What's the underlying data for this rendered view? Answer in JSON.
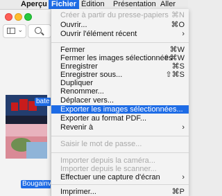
{
  "menubar": {
    "apple_glyph": "",
    "app_name": "Aperçu",
    "menus": [
      "Fichier",
      "Édition",
      "Présentation",
      "Aller"
    ]
  },
  "window": {
    "thumbnails": [
      {
        "label": "bate"
      },
      {
        "label": "Bougainv"
      }
    ]
  },
  "file_menu": {
    "items": [
      {
        "label": "Créer à partir du presse-papiers",
        "shortcut": "⌘N",
        "disabled": true
      },
      {
        "label": "Ouvrir...",
        "shortcut": "⌘O"
      },
      {
        "label": "Ouvrir l'élément récent",
        "shortcut": "›"
      },
      {
        "label": "Fermer",
        "shortcut": "⌘W"
      },
      {
        "label": "Fermer les images sélectionnées",
        "shortcut": "⇧⌘W"
      },
      {
        "label": "Enregistrer",
        "shortcut": "⌘S"
      },
      {
        "label": "Enregistrer sous...",
        "shortcut": "⇧⌘S"
      },
      {
        "label": "Dupliquer",
        "shortcut": ""
      },
      {
        "label": "Renommer...",
        "shortcut": ""
      },
      {
        "label": "Déplacer vers...",
        "shortcut": ""
      },
      {
        "label": "Exporter les images sélectionnées...",
        "shortcut": "",
        "highlighted": true
      },
      {
        "label": "Exporter au format PDF...",
        "shortcut": ""
      },
      {
        "label": "Revenir à",
        "shortcut": "›"
      },
      {
        "label": "Saisir le mot de passe...",
        "shortcut": "",
        "disabled": true
      },
      {
        "label": "Importer depuis la caméra...",
        "shortcut": "",
        "disabled": true
      },
      {
        "label": "Importer depuis le scanner...",
        "shortcut": "",
        "disabled": true
      },
      {
        "label": "Effectuer une capture d'écran",
        "shortcut": "›"
      },
      {
        "label": "Imprimer...",
        "shortcut": "⌘P"
      }
    ]
  },
  "colors": {
    "highlight": "#1e6ce6",
    "menu_bg": "#f3f3f3",
    "disabled_text": "#a9a9a9"
  }
}
